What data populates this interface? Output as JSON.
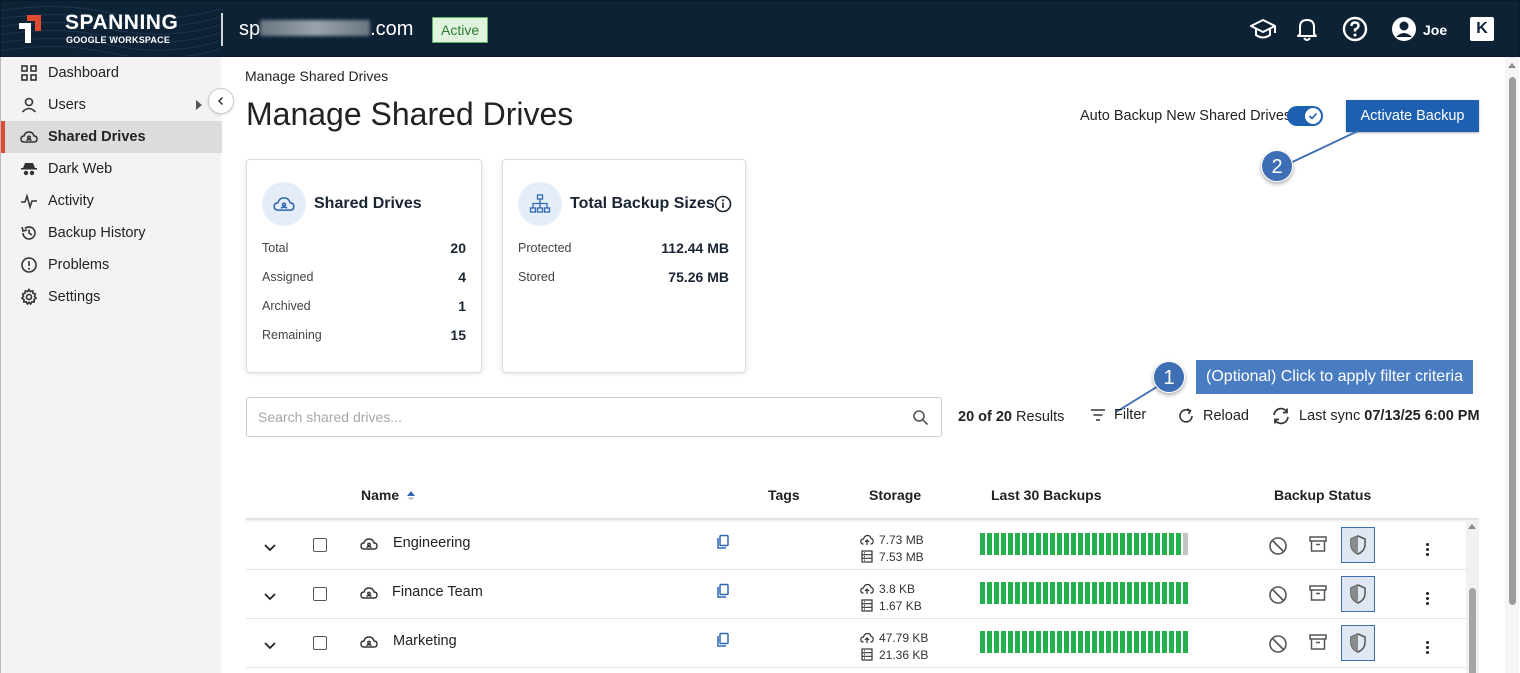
{
  "header": {
    "brand": "SPANNING",
    "brand_sub": "GOOGLE WORKSPACE",
    "domain_prefix": "sp",
    "domain_suffix": ".com",
    "status_badge": "Active",
    "user_name": "Joe",
    "k_logo": "K"
  },
  "sidebar": {
    "items": [
      {
        "label": "Dashboard",
        "icon": "grid-icon"
      },
      {
        "label": "Users",
        "icon": "user-icon"
      },
      {
        "label": "Shared Drives",
        "icon": "shared-drive-icon",
        "selected": true
      },
      {
        "label": "Dark Web",
        "icon": "spy-icon"
      },
      {
        "label": "Activity",
        "icon": "activity-icon"
      },
      {
        "label": "Backup History",
        "icon": "history-icon"
      },
      {
        "label": "Problems",
        "icon": "alert-icon"
      },
      {
        "label": "Settings",
        "icon": "gear-icon"
      }
    ]
  },
  "page": {
    "breadcrumb": "Manage Shared Drives",
    "title": "Manage Shared Drives",
    "auto_backup_label": "Auto Backup New Shared Drives",
    "auto_backup_enabled": true,
    "activate_button": "Activate Backup"
  },
  "callouts": {
    "one": "1",
    "two": "2",
    "filter_hint": "(Optional) Click to apply filter criteria"
  },
  "cards": {
    "shared_drives": {
      "title": "Shared Drives",
      "rows": [
        {
          "label": "Total",
          "value": "20"
        },
        {
          "label": "Assigned",
          "value": "4"
        },
        {
          "label": "Archived",
          "value": "1"
        },
        {
          "label": "Remaining",
          "value": "15"
        }
      ]
    },
    "backup_sizes": {
      "title": "Total Backup Sizes",
      "rows": [
        {
          "label": "Protected",
          "value": "112.44 MB"
        },
        {
          "label": "Stored",
          "value": "75.26 MB"
        }
      ]
    }
  },
  "toolbar": {
    "search_placeholder": "Search shared drives...",
    "results_count": "20 of 20",
    "results_label": "Results",
    "filter_label": "Filter",
    "reload_label": "Reload",
    "last_sync_label": "Last sync",
    "last_sync_value": "07/13/25 6:00 PM"
  },
  "table": {
    "columns": {
      "name": "Name",
      "tags": "Tags",
      "storage": "Storage",
      "backups": "Last 30 Backups",
      "status": "Backup Status"
    },
    "rows": [
      {
        "name": "Engineering",
        "protected": "7.73 MB",
        "stored": "7.53 MB",
        "successful_backups": 29,
        "missing_backups": 1
      },
      {
        "name": "Finance Team",
        "protected": "3.8 KB",
        "stored": "1.67 KB",
        "successful_backups": 30,
        "missing_backups": 0
      },
      {
        "name": "Marketing",
        "protected": "47.79 KB",
        "stored": "21.36 KB",
        "successful_backups": 30,
        "missing_backups": 0
      }
    ]
  },
  "colors": {
    "topbar": "#0e2236",
    "accent": "#1d5fb0",
    "selected_marker": "#e04a2f",
    "backup_success": "#22b14c",
    "backup_missing": "#c4c4c4",
    "callout": "#3e6fb5"
  }
}
